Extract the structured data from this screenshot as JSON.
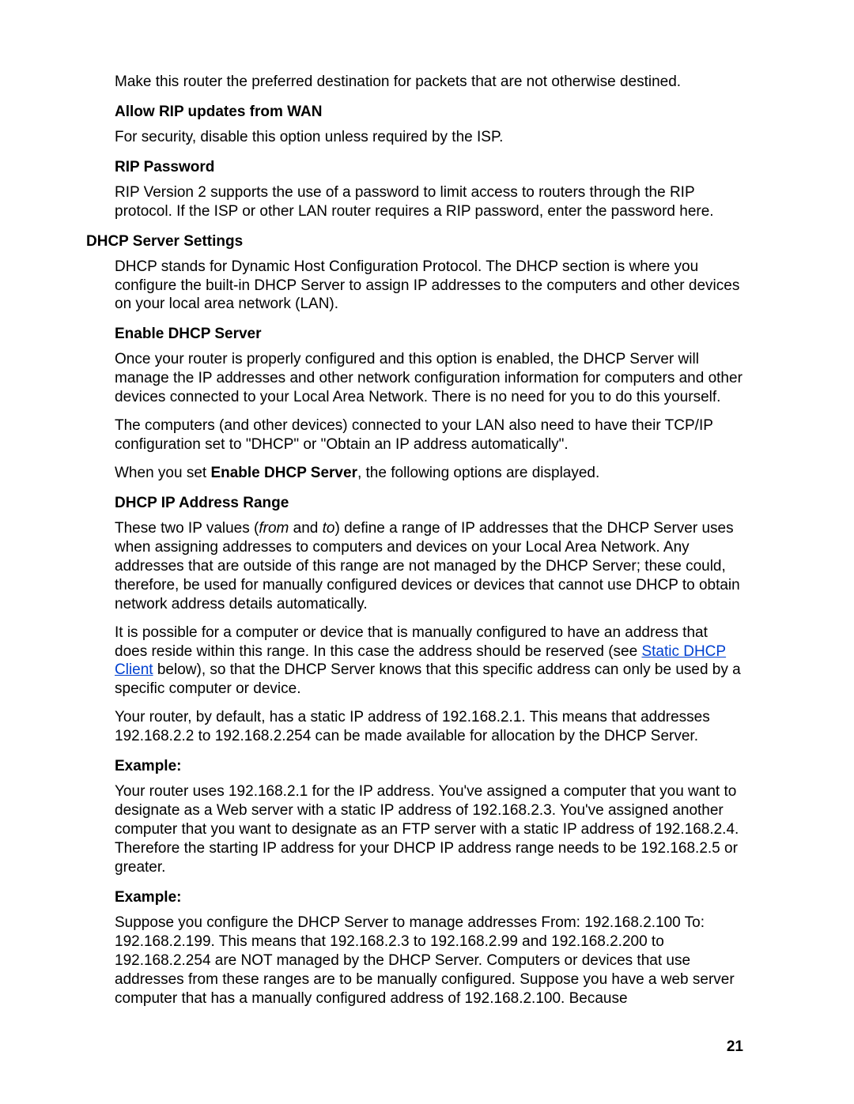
{
  "body": {
    "p_make_preferred": "Make this router the preferred destination for packets that are not otherwise destined.",
    "h_allow_rip": "Allow RIP updates from WAN",
    "p_allow_rip": "For security, disable this option unless required by the ISP.",
    "h_rip_pw": "RIP Password",
    "p_rip_pw": "RIP Version 2 supports the use of a password to limit access to routers through the RIP protocol. If the ISP or other LAN router requires a RIP password, enter the password here.",
    "h_dhcp_settings": "DHCP Server Settings",
    "p_dhcp_settings": "DHCP stands for Dynamic Host Configuration Protocol. The DHCP section is where you configure the built-in DHCP Server to assign IP addresses to the computers and other devices on your local area network (LAN).",
    "h_enable_dhcp": "Enable DHCP Server",
    "p_enable_dhcp_1": "Once your router is properly configured and this option is enabled, the DHCP Server will manage the IP addresses and other network configuration information for computers and other devices connected to your Local Area Network. There is no need for you to do this yourself.",
    "p_enable_dhcp_2": "The computers (and other devices) connected to your LAN also need to have their TCP/IP configuration set to \"DHCP\" or \"Obtain an IP address automatically\".",
    "p_enable_dhcp_3a": "When you set ",
    "p_enable_dhcp_3b": "Enable DHCP Server",
    "p_enable_dhcp_3c": ", the following options are displayed.",
    "h_ip_range": "DHCP IP Address Range",
    "p_ip_range_1a": "These two IP values (",
    "p_ip_range_1b": "from",
    "p_ip_range_1c": " and ",
    "p_ip_range_1d": "to",
    "p_ip_range_1e": ") define a range of IP addresses that the DHCP Server uses when assigning addresses to computers and devices on your Local Area Network. Any addresses that are outside of this range are not managed by the DHCP Server; these could, therefore, be used for manually configured devices or devices that cannot use DHCP to obtain network address details automatically.",
    "p_ip_range_2a": "It is possible for a computer or device that is manually configured to have an address that does reside within this range. In this case the address should be reserved (see ",
    "link_static_dhcp": "Static DHCP Client",
    "p_ip_range_2b": " below), so that the DHCP Server knows that this specific address can only be used by a specific computer or device.",
    "p_ip_range_3": "Your router, by default, has a static IP address of 192.168.2.1. This means that addresses 192.168.2.2 to 192.168.2.254 can be made available for allocation by the DHCP Server.",
    "h_example1": "Example:",
    "p_example1": "Your router uses 192.168.2.1 for the IP address. You've assigned a computer that you want to designate as a Web server with a static IP address of 192.168.2.3. You've assigned another computer that you want to designate as an FTP server with a static IP address of 192.168.2.4. Therefore the starting IP address for your DHCP IP address range needs to be 192.168.2.5 or greater.",
    "h_example2": "Example:",
    "p_example2": "Suppose you configure the DHCP Server to manage addresses From: 192.168.2.100 To: 192.168.2.199. This means that 192.168.2.3 to 192.168.2.99 and 192.168.2.200 to 192.168.2.254 are NOT managed by the DHCP Server. Computers or devices that use addresses from these ranges are to be manually configured. Suppose you have a web server computer that has a manually configured address of 192.168.2.100. Because"
  },
  "page_number": "21"
}
